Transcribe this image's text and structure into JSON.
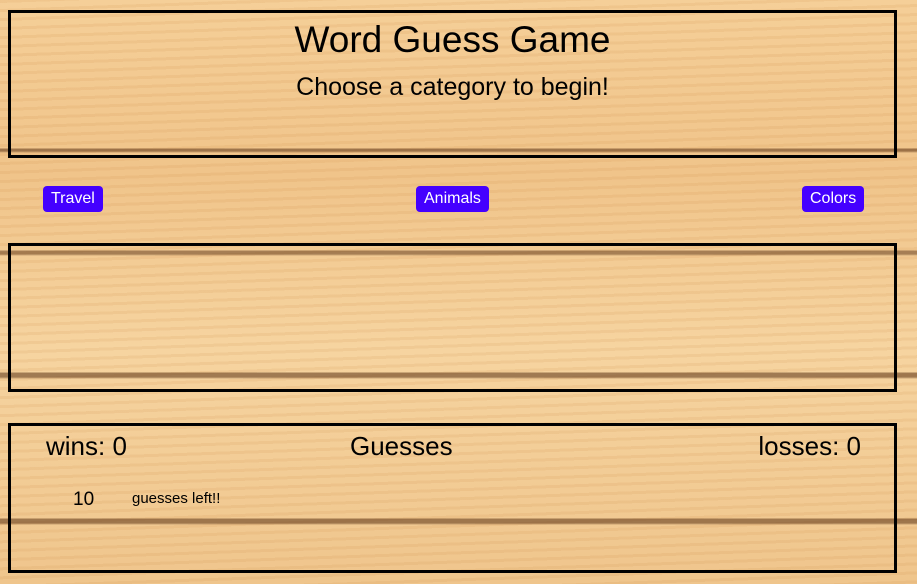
{
  "header": {
    "title": "Word Guess Game",
    "subtitle": "Choose a category to begin!"
  },
  "categories": [
    {
      "label": "Travel"
    },
    {
      "label": "Animals"
    },
    {
      "label": "Colors"
    }
  ],
  "word_display": "",
  "score": {
    "wins_label": "wins: 0",
    "guesses_label": "Guesses",
    "losses_label": "losses: 0",
    "guesses_left": "10",
    "guesses_left_text": "guesses left!!"
  },
  "colors": {
    "button": "#4400ff"
  }
}
